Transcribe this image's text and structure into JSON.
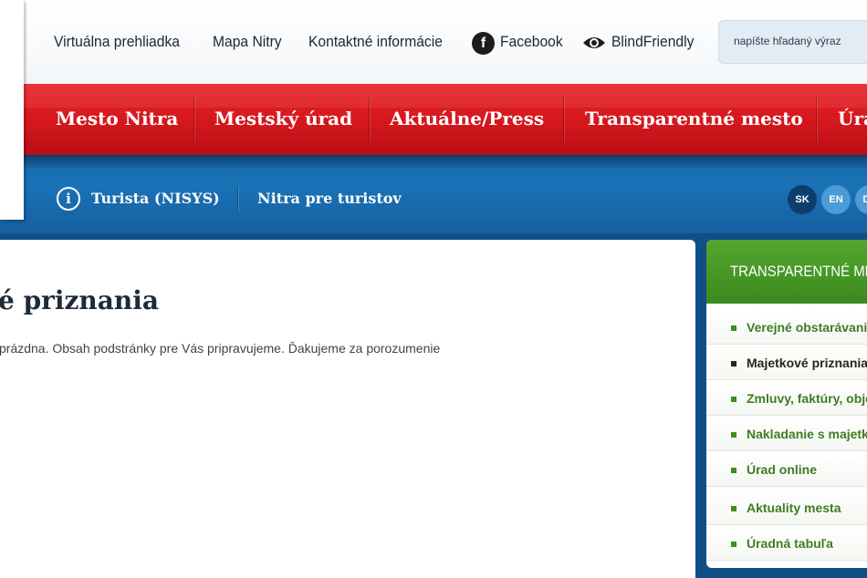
{
  "topbar": {
    "links": [
      "Virtuálna prehliadka",
      "Mapa Nitry",
      "Kontaktné informácie"
    ],
    "facebook": "Facebook",
    "blind_friendly": "BlindFriendly",
    "search_placeholder": "napíšte hľadaný výraz"
  },
  "main_nav": [
    "Mesto Nitra",
    "Mestský úrad",
    "Aktuálne/Press",
    "Transparentné mesto",
    "Úrad"
  ],
  "sub_nav": {
    "info_icon": "i",
    "items": [
      "Turista (NISYS)",
      "Nitra pre turistov"
    ]
  },
  "languages": [
    "SK",
    "EN",
    "DE"
  ],
  "page": {
    "title": "é priznania",
    "message": "prázdna. Obsah podstránky pre Vás pripravujeme. Ďakujeme za porozumenie"
  },
  "sidebar": {
    "title": "TRANSPARENTNÉ MESTO",
    "items": [
      "Verejné obstarávanie",
      "Majetkové priznania",
      "Zmluvy, faktúry, objednávky",
      "Nakladanie s majetkom",
      "Úrad online",
      "Aktuality mesta",
      "Úradná tabuľa"
    ],
    "active_index": 1
  },
  "colors": {
    "red_nav": "#d4171d",
    "blue_nav": "#1a72b6",
    "green_header": "#4a9a2a",
    "sidebar_link": "#3e7d24"
  },
  "icons": [
    "facebook-icon",
    "eye-icon",
    "info-icon",
    "bullet-icon"
  ]
}
